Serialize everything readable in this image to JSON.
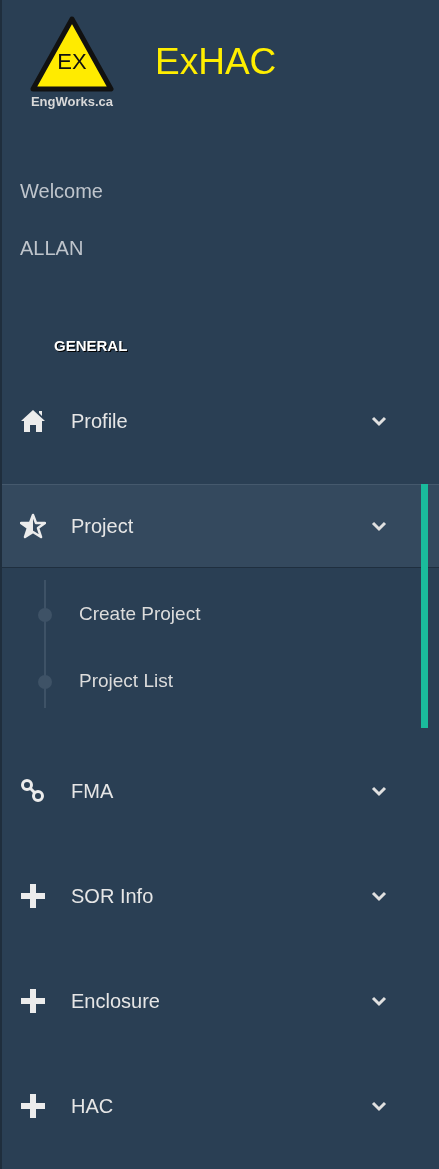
{
  "logo": {
    "sign": "EX",
    "caption": "EngWorks.ca"
  },
  "app_title": "ExHAC",
  "welcome": "Welcome",
  "user": "ALLAN",
  "section": "GENERAL",
  "menu": [
    {
      "label": "Profile",
      "kind": "home",
      "selected": false
    },
    {
      "label": "Project",
      "kind": "star",
      "selected": true,
      "children": [
        {
          "label": "Create Project"
        },
        {
          "label": "Project List"
        }
      ]
    },
    {
      "label": "FMA",
      "kind": "link",
      "selected": false
    },
    {
      "label": "SOR Info",
      "kind": "plus",
      "selected": false
    },
    {
      "label": "Enclosure",
      "kind": "plus",
      "selected": false
    },
    {
      "label": "HAC",
      "kind": "plus",
      "selected": false
    }
  ]
}
